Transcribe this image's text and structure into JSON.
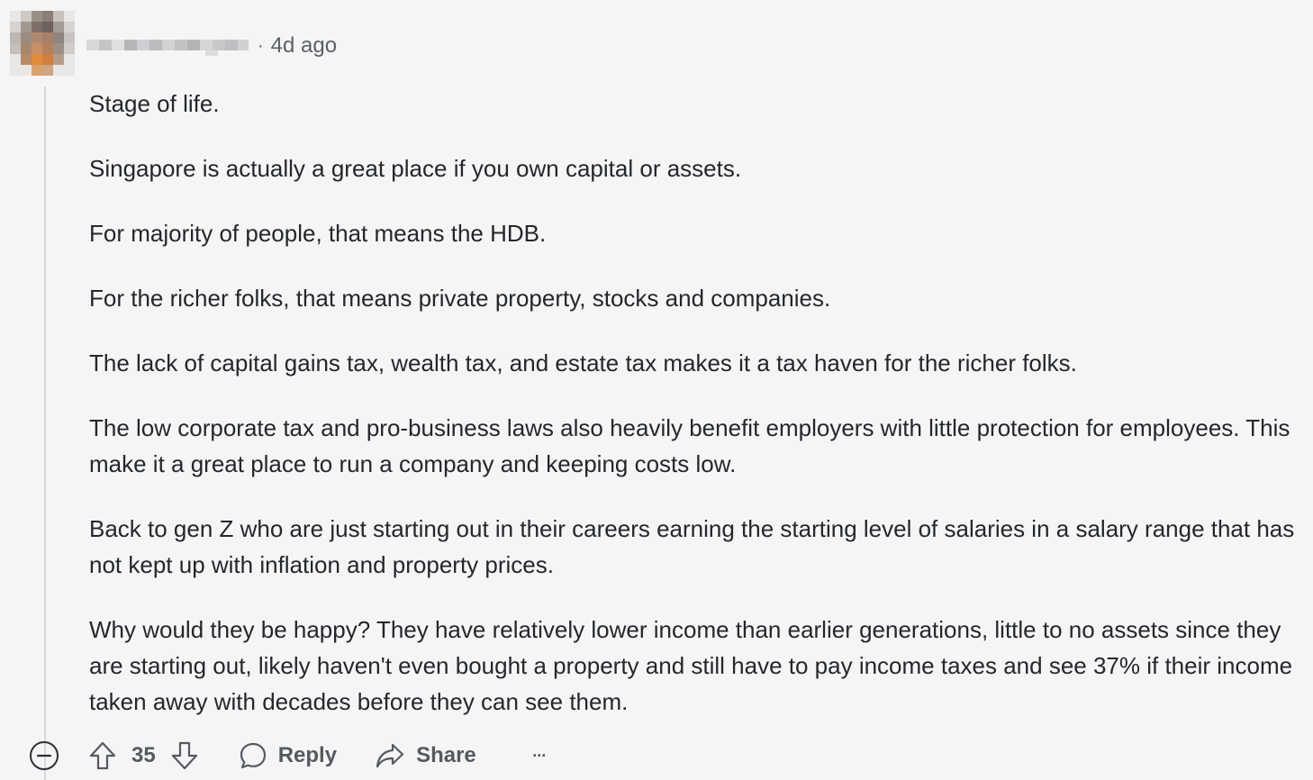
{
  "comment": {
    "timestamp": "4d ago",
    "separator": "·",
    "paragraphs": [
      "Stage of life.",
      "Singapore is actually a great place if you own capital or assets.",
      "For majority of people, that means the HDB.",
      "For the richer folks, that means private property, stocks and companies.",
      "The lack of capital gains tax, wealth tax, and estate tax makes it a tax haven for the richer folks.",
      "The low corporate tax and pro-business laws also heavily benefit employers with little protection for employees. This make it a great place to run a company and keeping costs low.",
      "Back to gen Z who are just starting out in their careers earning the starting level of salaries in a salary range that has not kept up with inflation and property prices.",
      "Why would they be happy? They have relatively lower income than earlier generations, little to no assets since they are starting out, likely haven't even bought a property and still have to pay income taxes and see 37% if their income taken away with decades before they can see them."
    ]
  },
  "actions": {
    "vote_count": "35",
    "reply_label": "Reply",
    "share_label": "Share",
    "more_label": "···"
  },
  "icons": {
    "collapse": "minus-circle-icon",
    "upvote": "arrow-up-icon",
    "downvote": "arrow-down-icon",
    "reply": "speech-bubble-icon",
    "share": "share-arrow-icon",
    "more": "ellipsis-icon"
  }
}
